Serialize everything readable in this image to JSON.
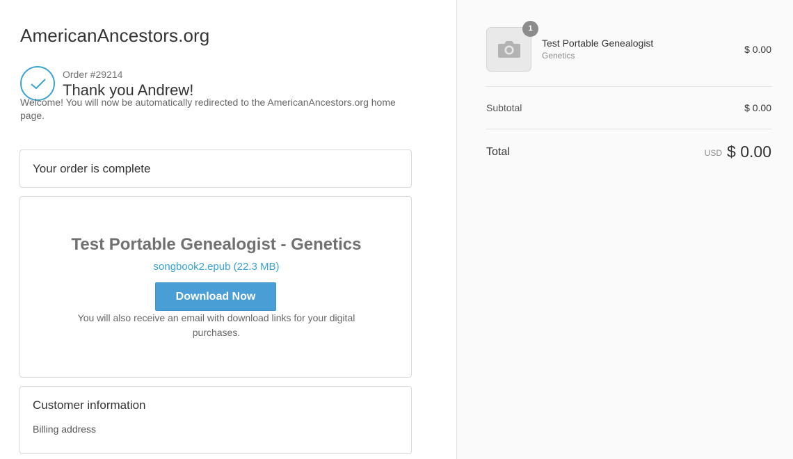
{
  "store": {
    "name": "AmericanAncestors.org"
  },
  "confirmation": {
    "order_number": "Order #29214",
    "thank_you": "Thank you Andrew!",
    "welcome": "Welcome! You will now be automatically redirected to the AmericanAncestors.org home page."
  },
  "order_status": {
    "title": "Your order is complete"
  },
  "download": {
    "title": "Test Portable Genealogist - Genetics",
    "file_link": "songbook2.epub (22.3 MB)",
    "button_label": "Download Now",
    "note": "You will also receive an email with download links for your digital purchases."
  },
  "customer": {
    "title": "Customer information",
    "billing_label": "Billing address"
  },
  "summary": {
    "product": {
      "quantity": "1",
      "name": "Test Portable Genealogist",
      "variant": "Genetics",
      "price": "$ 0.00",
      "image_icon": "camera-icon"
    },
    "subtotal_label": "Subtotal",
    "subtotal_value": "$ 0.00",
    "total_label": "Total",
    "total_currency": "USD",
    "total_value": "$ 0.00"
  },
  "colors": {
    "accent": "#3aa3cf",
    "button": "#4a9ed6",
    "sidebar_bg": "#fafafa"
  }
}
